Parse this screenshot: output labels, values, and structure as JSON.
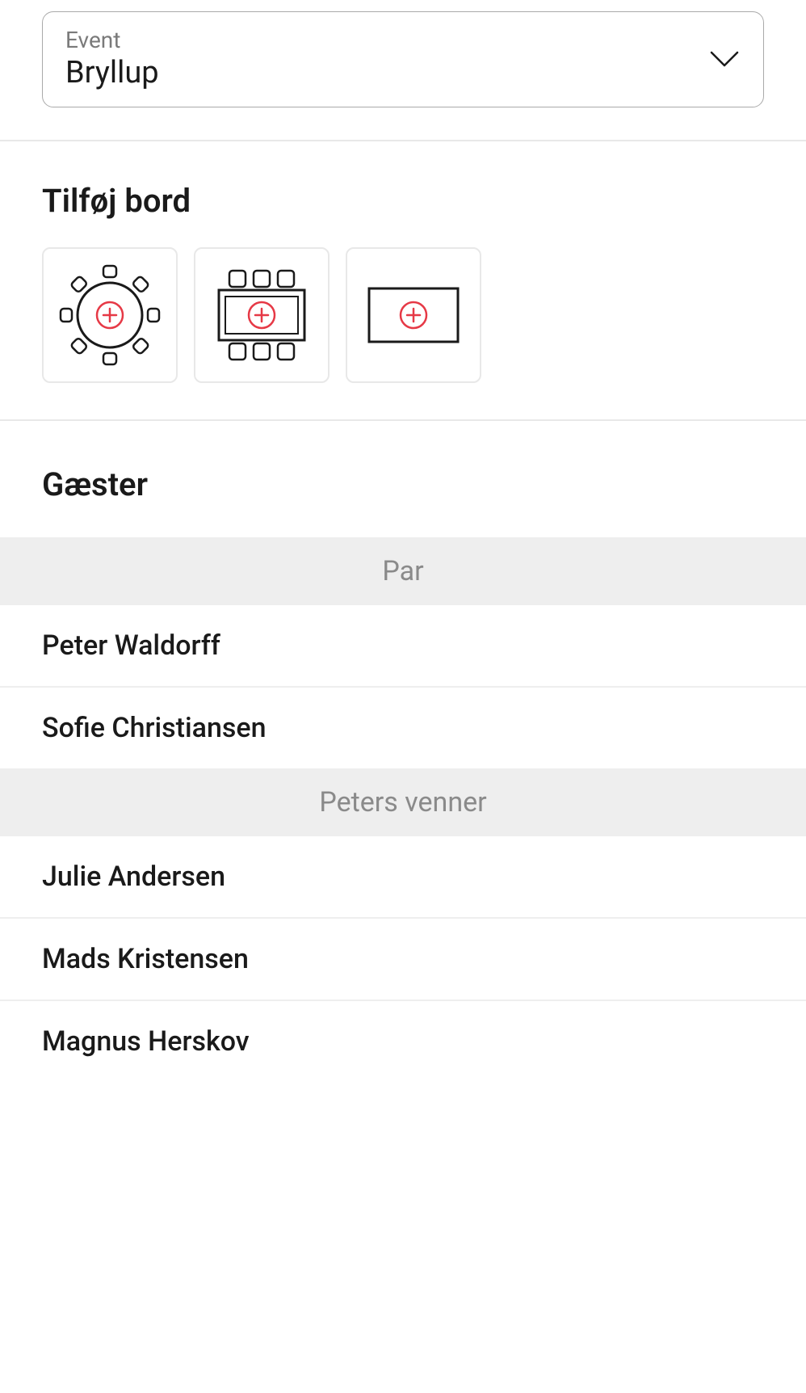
{
  "event": {
    "label": "Event",
    "value": "Bryllup"
  },
  "addTable": {
    "title": "Tilføj bord"
  },
  "guests": {
    "title": "Gæster",
    "groups": [
      {
        "name": "Par",
        "members": [
          "Peter Waldorff",
          "Sofie Christiansen"
        ]
      },
      {
        "name": "Peters venner",
        "members": [
          "Julie Andersen",
          "Mads Kristensen",
          "Magnus Herskov"
        ]
      }
    ]
  },
  "colors": {
    "accent": "#e63946",
    "iconStroke": "#1a1a1a"
  }
}
